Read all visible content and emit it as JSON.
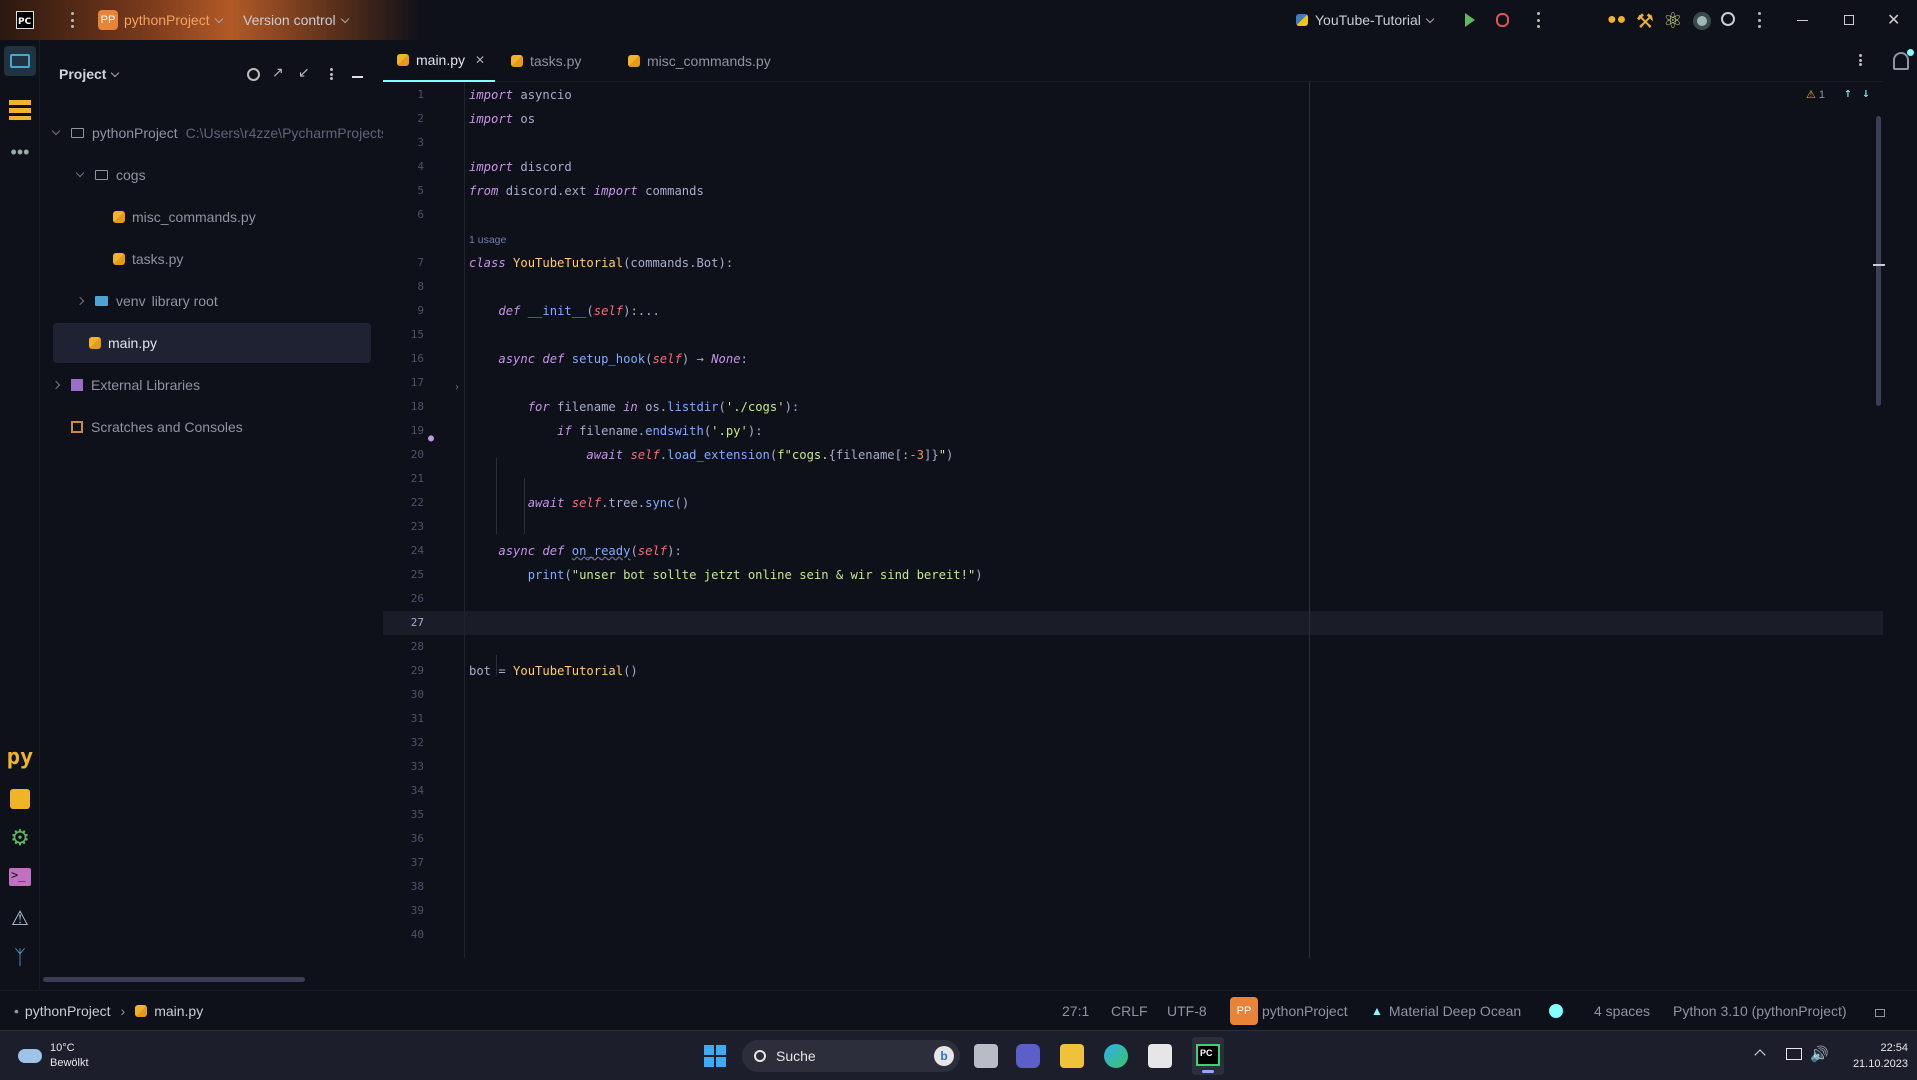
{
  "titlebar": {
    "project_badge": "PP",
    "project_name": "pythonProject",
    "vcs_label": "Version control",
    "run_config": "YouTube-Tutorial"
  },
  "project_panel": {
    "title": "Project",
    "tree": [
      {
        "label": "pythonProject",
        "path": "C:\\Users\\r4zze\\PycharmProjects",
        "type": "folder",
        "expanded": true
      },
      {
        "label": "cogs",
        "type": "folder",
        "expanded": true
      },
      {
        "label": "misc_commands.py",
        "type": "py"
      },
      {
        "label": "tasks.py",
        "type": "py"
      },
      {
        "label": "venv",
        "suffix": "library root",
        "type": "folder",
        "expanded": false
      },
      {
        "label": "main.py",
        "type": "py",
        "selected": true
      },
      {
        "label": "External Libraries",
        "type": "lib",
        "expanded": false
      },
      {
        "label": "Scratches and Consoles",
        "type": "scratch"
      }
    ]
  },
  "tabs": [
    {
      "label": "main.py",
      "active": true
    },
    {
      "label": "tasks.py",
      "active": false
    },
    {
      "label": "misc_commands.py",
      "active": false
    }
  ],
  "editor": {
    "warnings_count": "1",
    "usage_hint": "1 usage",
    "line_numbers": [
      "1",
      "2",
      "3",
      "4",
      "5",
      "6",
      "7",
      "8",
      "9",
      "15",
      "16",
      "17",
      "18",
      "19",
      "20",
      "21",
      "22",
      "23",
      "24",
      "25",
      "26",
      "27",
      "28",
      "29",
      "30",
      "31",
      "32",
      "33",
      "34",
      "35",
      "36",
      "37",
      "38",
      "39",
      "40"
    ]
  },
  "statusbar": {
    "breadcrumb_project": "pythonProject",
    "breadcrumb_file": "main.py",
    "position": "27:1",
    "line_sep": "CRLF",
    "encoding": "UTF-8",
    "project_badge": "PP",
    "project": "pythonProject",
    "theme": "Material Deep Ocean",
    "indent": "4 spaces",
    "interpreter": "Python 3.10 (pythonProject)"
  },
  "taskbar": {
    "temperature": "10°C",
    "weather": "Bewölkt",
    "search_placeholder": "Suche",
    "time": "22:54",
    "date": "21.10.2023"
  },
  "colors": {
    "background": "#0f111a",
    "accent": "#84ffff",
    "keyword": "#c792ea",
    "function": "#82aaff",
    "class": "#ffcb6b",
    "string": "#c3e88d"
  }
}
